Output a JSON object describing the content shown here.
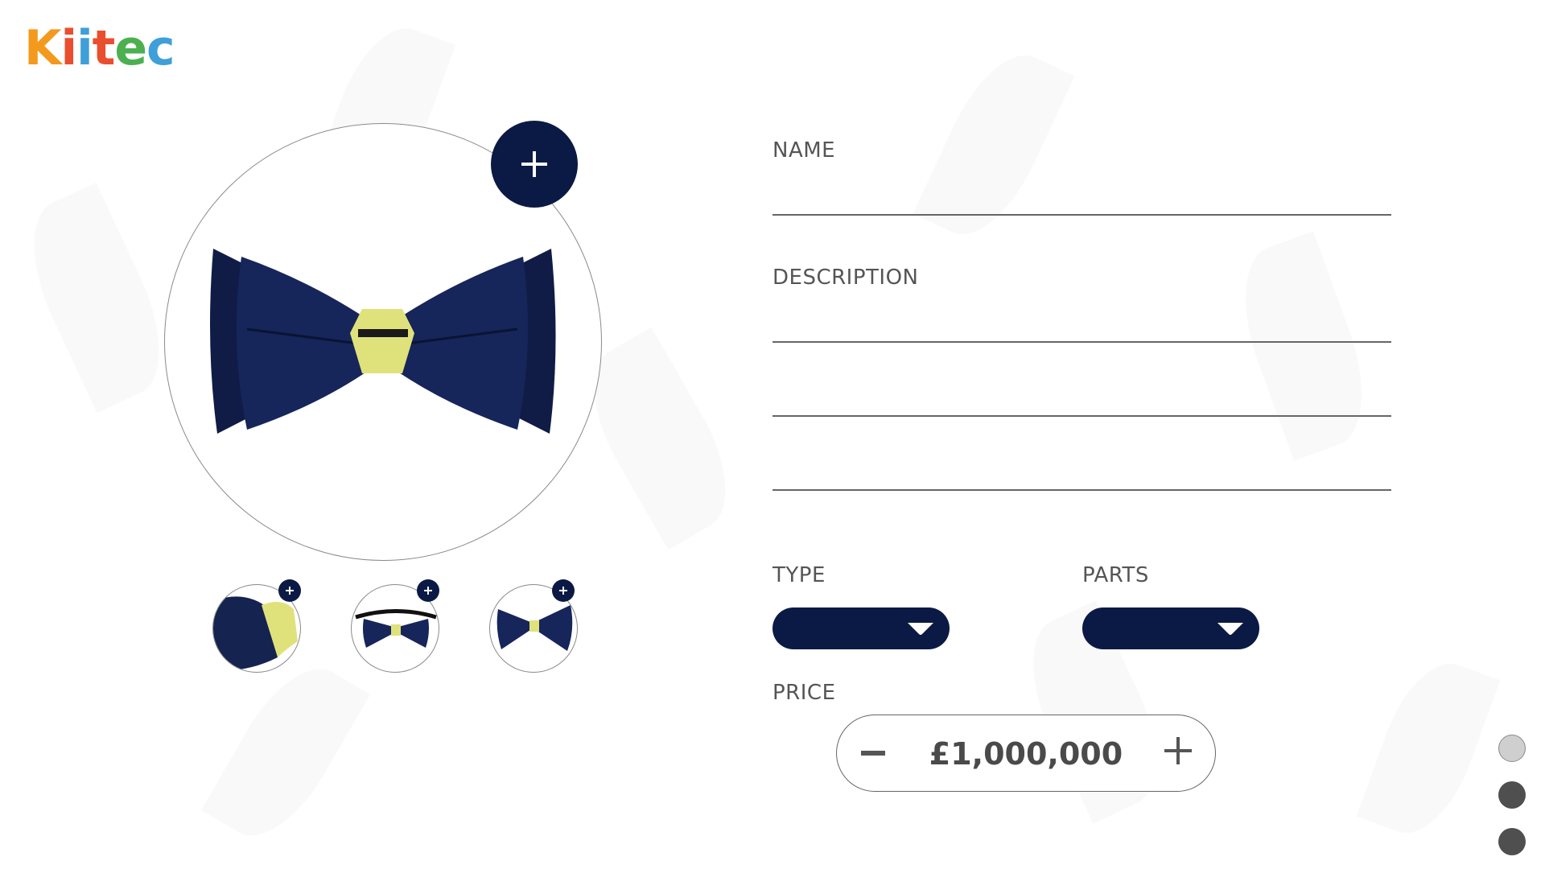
{
  "brand": {
    "logo_letters": [
      {
        "ch": "K",
        "color": "#f39a1e"
      },
      {
        "ch": "i",
        "color": "#e94f2e"
      },
      {
        "ch": "i",
        "color": "#3f9fd8"
      },
      {
        "ch": "t",
        "color": "#e94f2e"
      },
      {
        "ch": "e",
        "color": "#4cb050"
      },
      {
        "ch": "c",
        "color": "#3f9fd8"
      }
    ]
  },
  "product": {
    "main_image": "bow-tie-navy-front",
    "thumbnails": [
      {
        "image": "bow-tie-closeup"
      },
      {
        "image": "bow-tie-with-strap"
      },
      {
        "image": "bow-tie-angled"
      }
    ]
  },
  "form": {
    "name_label": "NAME",
    "name_value": "",
    "description_label": "DESCRIPTION",
    "description_lines": [
      "",
      "",
      ""
    ],
    "type_label": "TYPE",
    "type_value": "",
    "parts_label": "PARTS",
    "parts_value": "",
    "price_label": "PRICE",
    "price_value": "£1,000,000"
  },
  "pagination": {
    "dots": [
      {
        "state": "inactive",
        "color": "#cfcfcf"
      },
      {
        "state": "active",
        "color": "#4f4f4f"
      },
      {
        "state": "active",
        "color": "#4f4f4f"
      }
    ]
  },
  "colors": {
    "accent_navy": "#0b1a44",
    "bow_tie_band": "#dfe27a",
    "text_gray": "#555555"
  }
}
